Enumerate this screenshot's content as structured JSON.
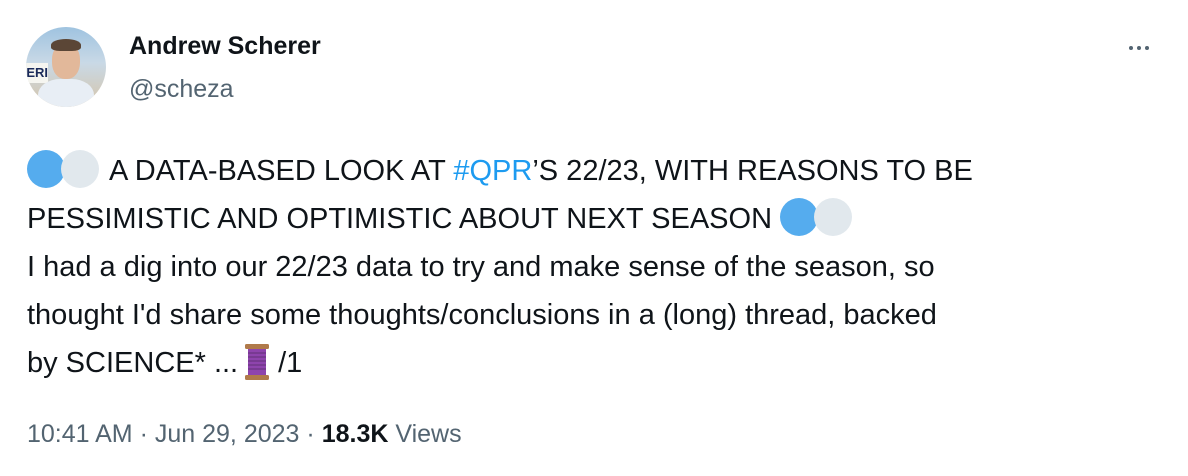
{
  "author": {
    "name": "Andrew Scherer",
    "handle": "@scheza",
    "avatar_sign_text": "ERI"
  },
  "tweet": {
    "line1_before_hashtag": "A DATA-BASED LOOK AT ",
    "hashtag": "#QPR",
    "line1_after_hashtag": "’S 22/23, WITH REASONS TO BE",
    "line2": "PESSIMISTIC AND OPTIMISTIC ABOUT NEXT SEASON",
    "line3": "I had a dig into our 22/23 data to try and make sense of the season, so",
    "line4": "thought I'd share some thoughts/conclusions in a (long) thread, backed",
    "line5_before_emoji": "by SCIENCE* ...",
    "line5_after_emoji": "/1",
    "emoji_icons": [
      "blue-circle-icon",
      "white-circle-icon",
      "thread-spool-icon"
    ]
  },
  "meta": {
    "time": "10:41 AM",
    "separator": "·",
    "date": "Jun 29, 2023",
    "views_count": "18.3K",
    "views_label": "Views"
  },
  "colors": {
    "text": "#0f1419",
    "secondary": "#536471",
    "link": "#1d9bf0",
    "emoji_blue": "#55acee",
    "emoji_white": "#e1e8ed"
  }
}
